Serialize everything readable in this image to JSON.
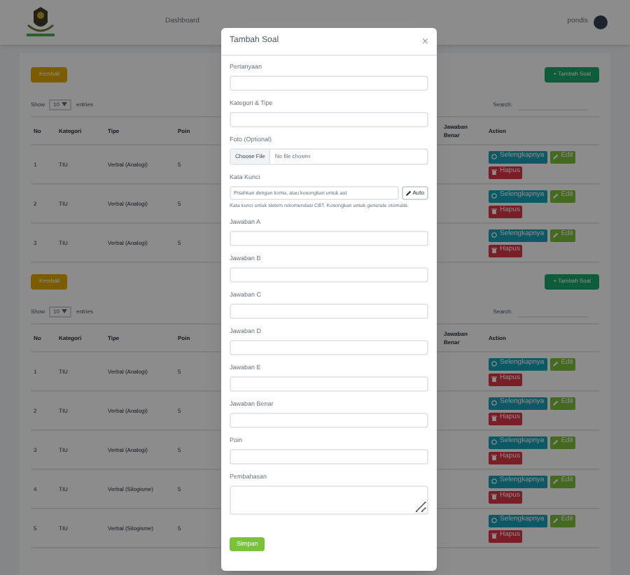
{
  "navbar": {
    "menu": [
      "Dashboard"
    ],
    "user": "pondis"
  },
  "sections": [
    {
      "back_button": "Kembali",
      "add_button": "+ Tambah Soal",
      "show": "Show",
      "page_size": "10",
      "entries": "entries",
      "search_label": "Search:",
      "columns": [
        "No",
        "Kategori",
        "Tipe",
        "Poin",
        "Jawaban Benar",
        "Action"
      ],
      "rows": [
        {
          "no": "1",
          "kategori": "TIU",
          "tipe": "Verbal (Analogi)",
          "poin": "5",
          "actions": {
            "detail": "Selengkapnya",
            "edit": "Edit",
            "delete": "Hapus"
          }
        },
        {
          "no": "2",
          "kategori": "TIU",
          "tipe": "Verbal (Analogi)",
          "poin": "5",
          "actions": {
            "detail": "Selengkapnya",
            "edit": "Edit",
            "delete": "Hapus"
          }
        },
        {
          "no": "3",
          "kategori": "TIU",
          "tipe": "Verbal (Analogi)",
          "poin": "5",
          "actions": {
            "detail": "Selengkapnya",
            "edit": "Edit",
            "delete": "Hapus"
          }
        }
      ]
    },
    {
      "back_button": "Kembali",
      "add_button": "+ Tambah Soal",
      "show": "Show",
      "page_size": "10",
      "entries": "entries",
      "search_label": "Search:",
      "columns": [
        "No",
        "Kategori",
        "Tipe",
        "Poin",
        "Jawaban Benar",
        "Action"
      ],
      "rows": [
        {
          "no": "1",
          "kategori": "TIU",
          "tipe": "Verbal (Analogi)",
          "poin": "5",
          "actions": {
            "detail": "Selengkapnya",
            "edit": "Edit",
            "delete": "Hapus"
          }
        },
        {
          "no": "2",
          "kategori": "TIU",
          "tipe": "Verbal (Analogi)",
          "poin": "5",
          "actions": {
            "detail": "Selengkapnya",
            "edit": "Edit",
            "delete": "Hapus"
          }
        },
        {
          "no": "3",
          "kategori": "TIU",
          "tipe": "Verbal (Analogi)",
          "poin": "5",
          "actions": {
            "detail": "Selengkapnya",
            "edit": "Edit",
            "delete": "Hapus"
          }
        },
        {
          "no": "4",
          "kategori": "TIU",
          "tipe": "Verbal (Silogisme)",
          "poin": "5",
          "actions": {
            "detail": "Selengkapnya",
            "edit": "Edit",
            "delete": "Hapus"
          }
        },
        {
          "no": "5",
          "kategori": "TIU",
          "tipe": "Verbal (Silogisme)",
          "poin": "5",
          "actions": {
            "detail": "Selengkapnya",
            "edit": "Edit",
            "delete": "Hapus"
          }
        }
      ]
    }
  ],
  "modal": {
    "title": "Tambah Soal",
    "close": "×",
    "fields": [
      {
        "kind": "input",
        "label": "Pertanyaan"
      },
      {
        "kind": "input",
        "label": "Kategori & Tipe"
      },
      {
        "kind": "file",
        "label": "Foto (Optional)",
        "button": "Choose File",
        "value": "No file chosen"
      },
      {
        "kind": "keywords",
        "label": "Kata Kunci",
        "placeholder": "Pisahkan dengan koma, atau kosongkan untuk aut",
        "button": "Auto",
        "help": "Kata kunci untuk sistem rekomendasi CBT. Kosongkan untuk generate otomatis."
      },
      {
        "kind": "input",
        "label": "Jawaban A"
      },
      {
        "kind": "input",
        "label": "Jawaban B"
      },
      {
        "kind": "input",
        "label": "Jawaban C"
      },
      {
        "kind": "input",
        "label": "Jawaban D"
      },
      {
        "kind": "input",
        "label": "Jawaban E"
      },
      {
        "kind": "input",
        "label": "Jawaban Benar"
      },
      {
        "kind": "input",
        "label": "Poin"
      },
      {
        "kind": "textarea",
        "label": "Pembahasan"
      }
    ],
    "submit": "Simpan"
  }
}
